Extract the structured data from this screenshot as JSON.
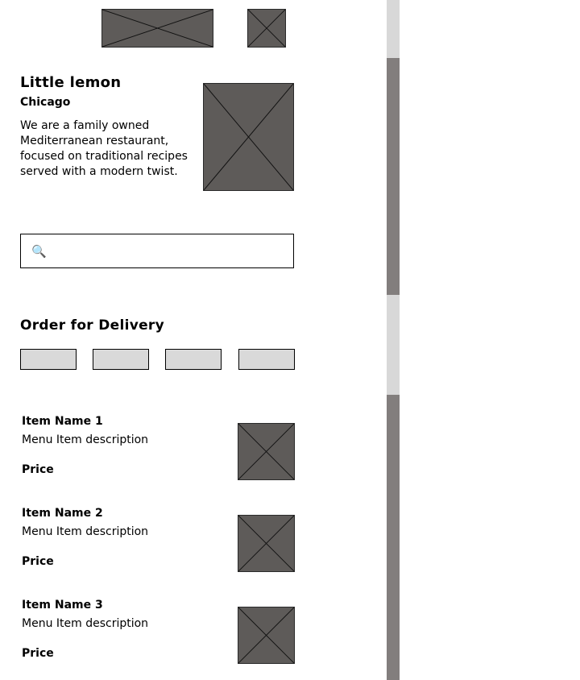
{
  "hero": {
    "title": "Little lemon",
    "subtitle": "Chicago",
    "description": "We are a family owned Mediterranean restaurant, focused on traditional recipes served with a modern twist."
  },
  "search": {
    "icon": "search-icon",
    "glyph": "🔍",
    "value": "",
    "placeholder": ""
  },
  "delivery": {
    "title": "Order for Delivery",
    "category_count_visible": 4
  },
  "menu_items": [
    {
      "name": "Item Name 1",
      "description": "Menu Item description",
      "price": "Price"
    },
    {
      "name": "Item Name 2",
      "description": "Menu Item description",
      "price": "Price"
    },
    {
      "name": "Item Name 3",
      "description": "Menu Item description",
      "price": "Price"
    }
  ],
  "colors": {
    "placeholder_fill": "#5e5b59",
    "chip_fill": "#d9d9d9",
    "scroll_track": "#d8d8d8",
    "scroll_thumb": "#827e7d"
  }
}
